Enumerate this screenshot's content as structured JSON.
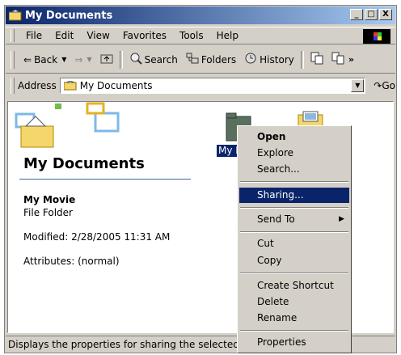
{
  "window": {
    "title": "My Documents",
    "min": "_",
    "max": "□",
    "close": "X"
  },
  "menu": [
    "File",
    "Edit",
    "View",
    "Favorites",
    "Tools",
    "Help"
  ],
  "toolbar": {
    "back": "Back",
    "search": "Search",
    "folders": "Folders",
    "history": "History"
  },
  "address": {
    "label": "Address",
    "value": "My Documents",
    "go": "Go"
  },
  "panel": {
    "title": "My Documents",
    "item_name": "My Movie",
    "item_type": "File Folder",
    "modified": "Modified: 2/28/2005 11:31 AM",
    "attributes": "Attributes: (normal)"
  },
  "files": [
    {
      "label": "My M"
    }
  ],
  "context_menu": {
    "open": "Open",
    "explore": "Explore",
    "search": "Search...",
    "sharing": "Sharing...",
    "send_to": "Send To",
    "cut": "Cut",
    "copy": "Copy",
    "create_shortcut": "Create Shortcut",
    "delete": "Delete",
    "rename": "Rename",
    "properties": "Properties"
  },
  "status": "Displays the properties for sharing the selected fo",
  "colors": {
    "titlebar": "#0a246a",
    "highlight": "#0a246a",
    "chrome": "#d4d0c8"
  }
}
